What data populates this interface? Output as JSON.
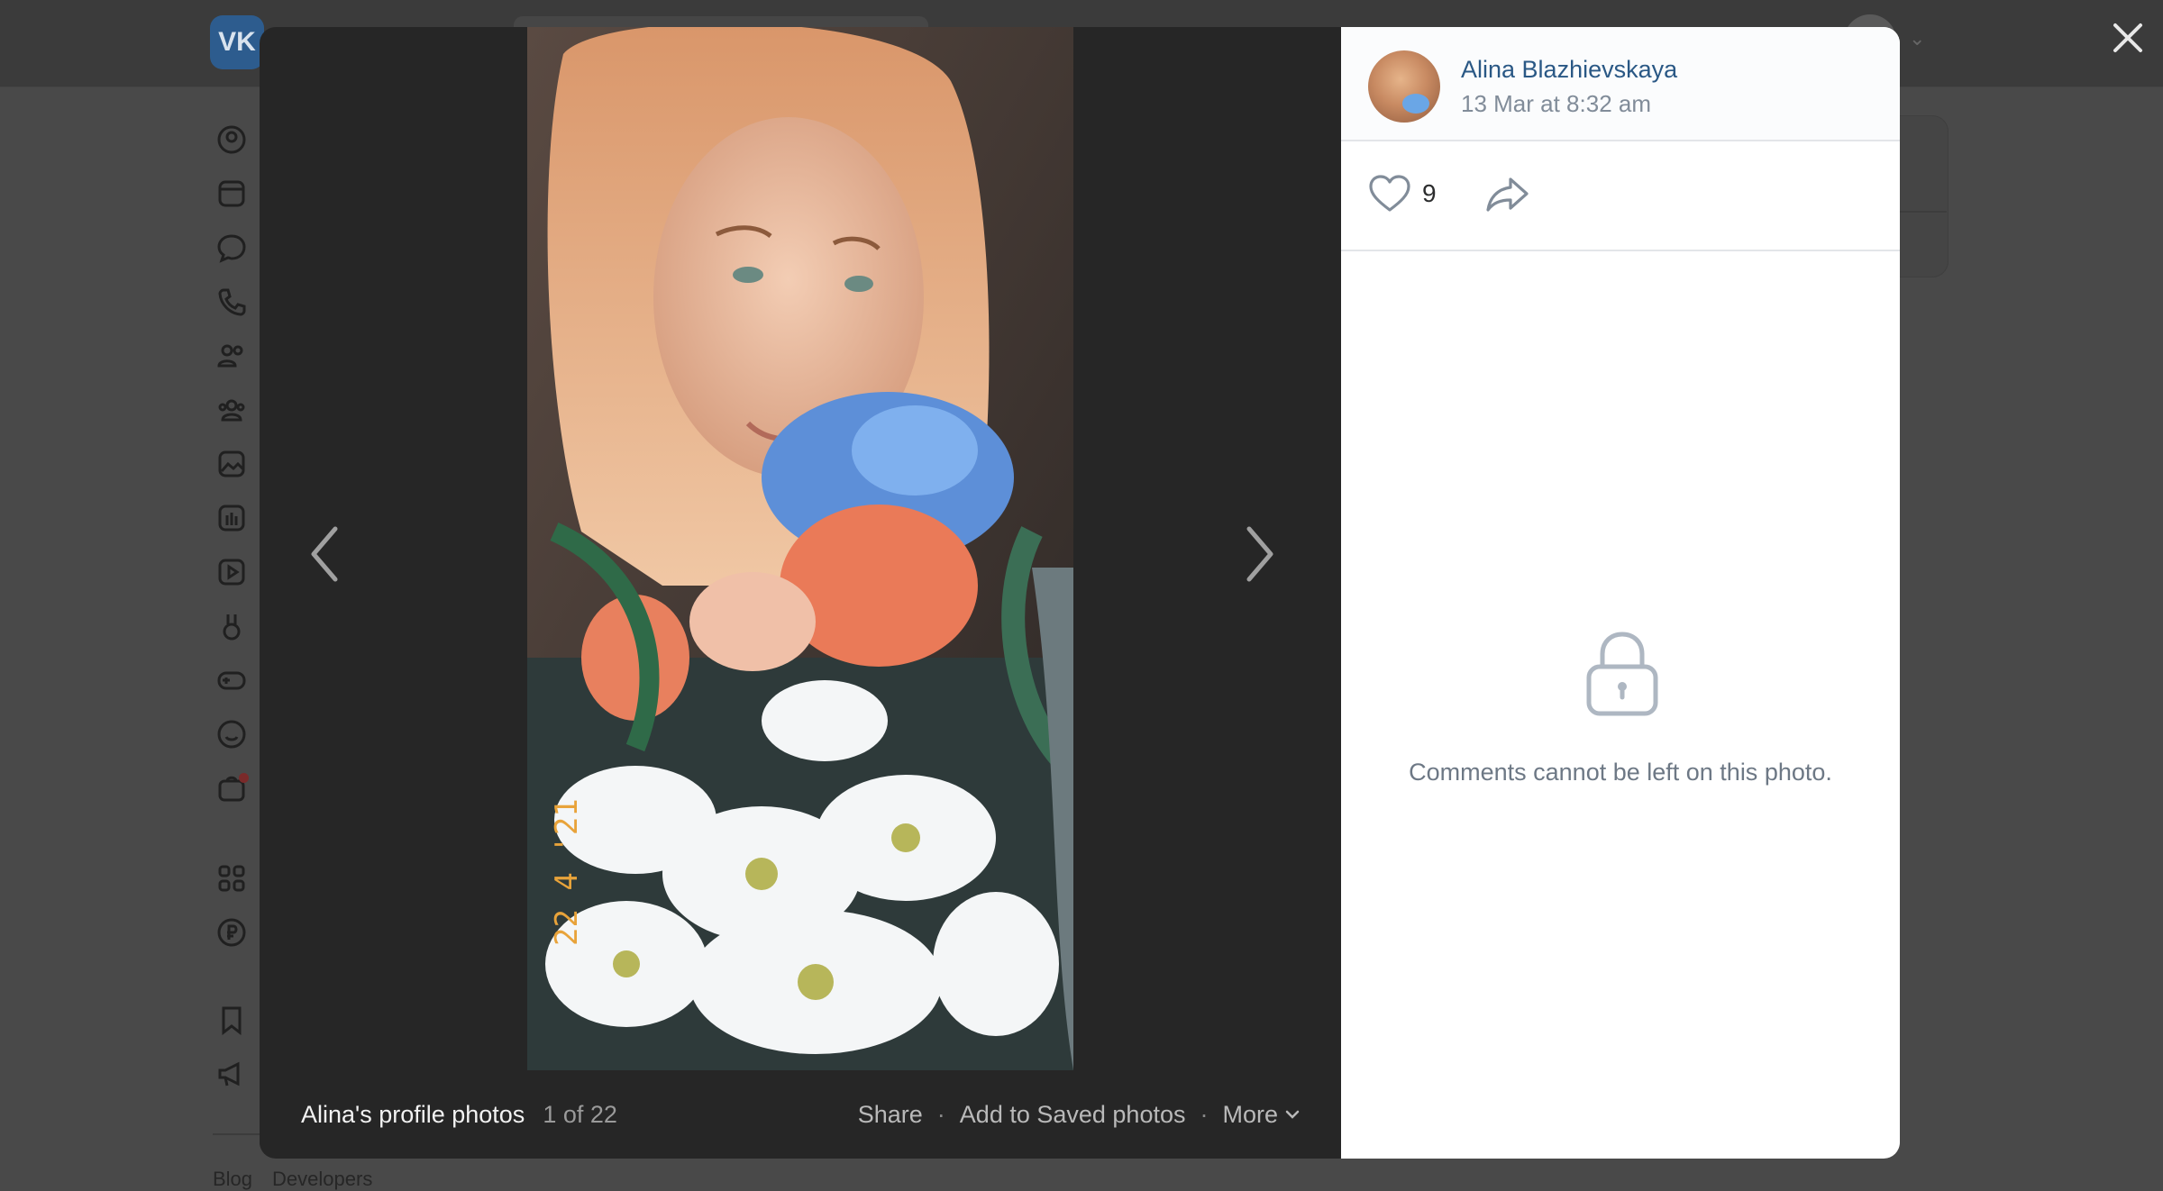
{
  "background": {
    "logo": "VK",
    "footer_links": [
      "Blog",
      "Developers"
    ]
  },
  "viewer": {
    "author": {
      "name": "Alina Blazhievskaya",
      "date": "13 Mar at 8:32 am"
    },
    "likes": "9",
    "comments_locked": "Comments cannot be left on this photo.",
    "photo_stamp": "22 4 '21",
    "footer": {
      "album_title": "Alina's profile photos",
      "counter": "1 of 22",
      "share": "Share",
      "separator": "·",
      "save": "Add to Saved photos",
      "more": "More"
    }
  },
  "colors": {
    "accent": "#2a5885",
    "muted": "#818c99",
    "overlay": "#262626"
  }
}
